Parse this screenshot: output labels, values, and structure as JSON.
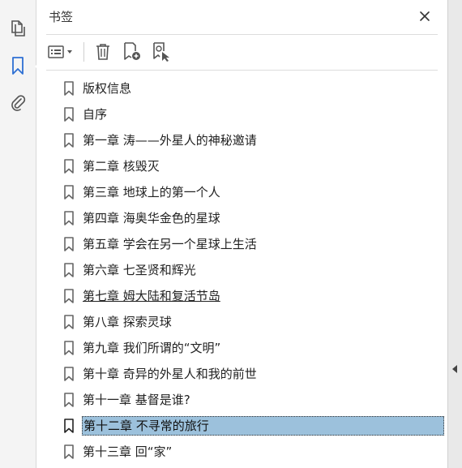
{
  "panel": {
    "title": "书签"
  },
  "rail": {
    "items": [
      {
        "name": "pages-icon",
        "state": "default"
      },
      {
        "name": "bookmark-icon",
        "state": "active"
      },
      {
        "name": "paperclip-icon",
        "state": "default"
      }
    ]
  },
  "toolbar": {
    "buttons": [
      "options-icon",
      "delete-icon",
      "new-bookmark-icon",
      "new-bookmark-from-structure-icon"
    ]
  },
  "bookmarks": [
    {
      "label": "版权信息"
    },
    {
      "label": "自序"
    },
    {
      "label": "第一章 涛——外星人的神秘邀请"
    },
    {
      "label": "第二章 核毁灭"
    },
    {
      "label": "第三章 地球上的第一个人"
    },
    {
      "label": "第四章 海奥华金色的星球"
    },
    {
      "label": "第五章 学会在另一个星球上生活"
    },
    {
      "label": "第六章 七圣贤和辉光"
    },
    {
      "label": "第七章 姆大陆和复活节岛",
      "state": "hover"
    },
    {
      "label": "第八章 探索灵球"
    },
    {
      "label": "第九章 我们所谓的“文明”"
    },
    {
      "label": "第十章 奇异的外星人和我的前世"
    },
    {
      "label": "第十一章 基督是谁?"
    },
    {
      "label": "第十二章 不寻常的旅行",
      "state": "selected"
    },
    {
      "label": "第十三章 回“家”"
    }
  ],
  "colors": {
    "accent": "#2d6fd3",
    "selection": "#9cc1dc",
    "icon": "#555555"
  }
}
